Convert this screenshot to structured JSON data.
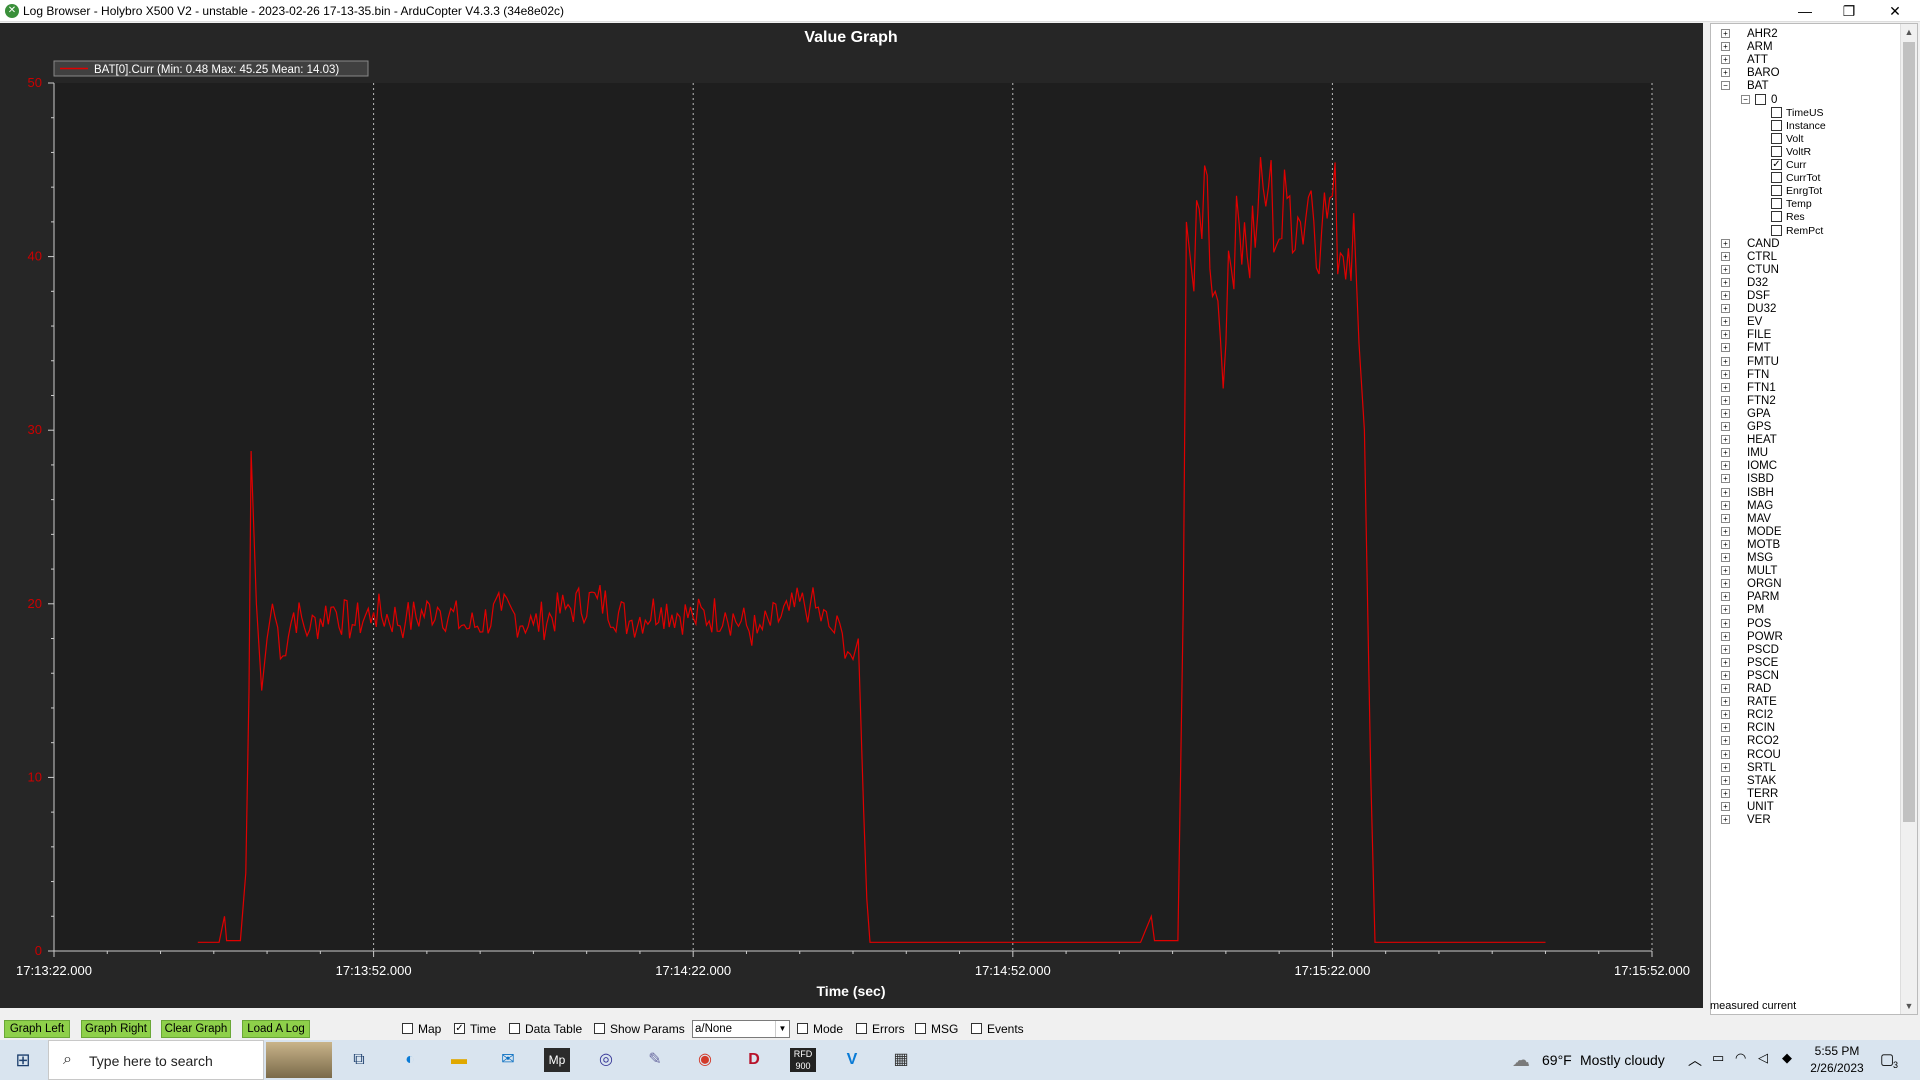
{
  "window": {
    "title": "Log Browser - Holybro X500 V2 - unstable - 2023-02-26 17-13-35.bin - ArduCopter V4.3.3 (34e8e02c)",
    "minimize": "—",
    "maximize": "❐",
    "close": "✕"
  },
  "graph": {
    "title": "Value Graph",
    "legend": "BAT[0].Curr  (Min: 0.48 Max: 45.25 Mean: 14.03)",
    "xlabel": "Time (sec)",
    "colors": {
      "line": "#e00000",
      "plot_bg": "#1e1e1e",
      "axis_labels": "#cc0000"
    }
  },
  "chart_data": {
    "type": "line",
    "title": "Value Graph",
    "xlabel": "Time (sec)",
    "ylabel": "",
    "x_ticks": [
      "17:13:22.000",
      "17:13:52.000",
      "17:14:22.000",
      "17:14:52.000",
      "17:15:22.000",
      "17:15:52.000"
    ],
    "y_ticks": [
      0,
      10,
      20,
      30,
      40,
      50
    ],
    "xlim": [
      "17:13:22",
      "17:15:52"
    ],
    "ylim": [
      0,
      50
    ],
    "grid": "vertical dotted",
    "legend_position": "top-left",
    "series": [
      {
        "name": "BAT[0].Curr  (Min: 0.48 Max: 45.25 Mean: 14.03)",
        "color": "#e00000",
        "points": [
          [
            "17:13:35.5",
            0.5
          ],
          [
            "17:13:37.5",
            0.5
          ],
          [
            "17:13:38.0",
            2.0
          ],
          [
            "17:13:38.2",
            0.6
          ],
          [
            "17:13:39.5",
            0.6
          ],
          [
            "17:13:40.0",
            4.5
          ],
          [
            "17:13:40.3",
            15.0
          ],
          [
            "17:13:40.5",
            28.8
          ],
          [
            "17:13:41.0",
            20.0
          ],
          [
            "17:13:41.5",
            15.0
          ],
          [
            "17:13:42.0",
            18.0
          ],
          [
            "17:13:42.5",
            20.0
          ],
          [
            "17:13:43.5",
            17.0
          ],
          [
            "17:13:44.5",
            19.5
          ],
          [
            "17:13:46",
            18.5
          ],
          [
            "17:13:48",
            19.8
          ],
          [
            "17:13:50",
            18.8
          ],
          [
            "17:13:52",
            19.5
          ],
          [
            "17:13:55",
            19.0
          ],
          [
            "17:13:58",
            19.8
          ],
          [
            "17:14:01",
            18.6
          ],
          [
            "17:14:04",
            19.6
          ],
          [
            "17:14:07",
            18.8
          ],
          [
            "17:14:10",
            19.7
          ],
          [
            "17:14:13",
            20.3
          ],
          [
            "17:14:16",
            19.0
          ],
          [
            "17:14:19",
            19.8
          ],
          [
            "17:14:22",
            19.2
          ],
          [
            "17:14:25",
            19.5
          ],
          [
            "17:14:28",
            18.3
          ],
          [
            "17:14:31",
            19.6
          ],
          [
            "17:14:33",
            20.0
          ],
          [
            "17:14:35",
            18.5
          ],
          [
            "17:14:36",
            18.3
          ],
          [
            "17:14:37",
            16.8
          ],
          [
            "17:14:37.5",
            18.0
          ],
          [
            "17:14:38.0",
            8.0
          ],
          [
            "17:14:38.3",
            3.0
          ],
          [
            "17:14:38.6",
            0.5
          ],
          [
            "17:14:45",
            0.5
          ],
          [
            "17:14:55",
            0.5
          ],
          [
            "17:15:04",
            0.5
          ],
          [
            "17:15:05",
            2.0
          ],
          [
            "17:15:05.3",
            0.6
          ],
          [
            "17:15:07.5",
            0.6
          ],
          [
            "17:15:08.0",
            20.0
          ],
          [
            "17:15:08.3",
            42.0
          ],
          [
            "17:15:09",
            38.0
          ],
          [
            "17:15:10",
            45.25
          ],
          [
            "17:15:11",
            38.0
          ],
          [
            "17:15:12",
            35.0
          ],
          [
            "17:15:13",
            43.5
          ],
          [
            "17:15:14",
            40.0
          ],
          [
            "17:15:15",
            42.5
          ],
          [
            "17:15:16",
            44.0
          ],
          [
            "17:15:17",
            41.0
          ],
          [
            "17:15:18",
            43.5
          ],
          [
            "17:15:19",
            42.0
          ],
          [
            "17:15:20",
            43.8
          ],
          [
            "17:15:21",
            41.5
          ],
          [
            "17:15:22",
            43.5
          ],
          [
            "17:15:23",
            40.0
          ],
          [
            "17:15:24",
            42.5
          ],
          [
            "17:15:24.5",
            35.0
          ],
          [
            "17:15:25",
            30.0
          ],
          [
            "17:15:25.6",
            10.0
          ],
          [
            "17:15:26.0",
            0.5
          ],
          [
            "17:15:35",
            0.5
          ],
          [
            "17:15:42",
            0.5
          ]
        ]
      }
    ]
  },
  "tree": {
    "groups_before": [
      "AHR2",
      "ARM",
      "ATT",
      "BARO"
    ],
    "expanded_group": "BAT",
    "instance": "0",
    "fields": [
      {
        "label": "TimeUS",
        "checked": false
      },
      {
        "label": "Instance",
        "checked": false
      },
      {
        "label": "Volt",
        "checked": false
      },
      {
        "label": "VoltR",
        "checked": false
      },
      {
        "label": "Curr",
        "checked": true
      },
      {
        "label": "CurrTot",
        "checked": false
      },
      {
        "label": "EnrgTot",
        "checked": false
      },
      {
        "label": "Temp",
        "checked": false
      },
      {
        "label": "Res",
        "checked": false
      },
      {
        "label": "RemPct",
        "checked": false
      }
    ],
    "groups_after": [
      "CAND",
      "CTRL",
      "CTUN",
      "D32",
      "DSF",
      "DU32",
      "EV",
      "FILE",
      "FMT",
      "FMTU",
      "FTN",
      "FTN1",
      "FTN2",
      "GPA",
      "GPS",
      "HEAT",
      "IMU",
      "IOMC",
      "ISBD",
      "ISBH",
      "MAG",
      "MAV",
      "MODE",
      "MOTB",
      "MSG",
      "MULT",
      "ORGN",
      "PARM",
      "PM",
      "POS",
      "POWR",
      "PSCD",
      "PSCE",
      "PSCN",
      "RAD",
      "RATE",
      "RCI2",
      "RCIN",
      "RCO2",
      "RCOU",
      "SRTL",
      "STAK",
      "TERR",
      "UNIT",
      "VER"
    ],
    "status": "measured current"
  },
  "toolbar": {
    "buttons": [
      "Graph Left",
      "Graph Right",
      "Clear Graph",
      "Load A Log"
    ],
    "options": [
      {
        "label": "Map",
        "checked": false
      },
      {
        "label": "Time",
        "checked": true
      },
      {
        "label": "Data Table",
        "checked": false
      },
      {
        "label": "Show Params",
        "checked": false
      }
    ],
    "combo_value": "a/None",
    "options2": [
      {
        "label": "Mode",
        "checked": false
      },
      {
        "label": "Errors",
        "checked": false
      },
      {
        "label": "MSG",
        "checked": false
      },
      {
        "label": "Events",
        "checked": false
      }
    ]
  },
  "taskbar": {
    "search_placeholder": "Type here to search",
    "weather_temp": "69°F",
    "weather_desc": "Mostly cloudy",
    "time": "5:55 PM",
    "date": "2/26/2023",
    "notifications": "3",
    "apps": [
      "windows-start-icon",
      "task-view-icon",
      "edge-icon",
      "file-explorer-icon",
      "mail-icon",
      "mission-planner-icon",
      "quicktime-icon",
      "feather-icon",
      "chrome-icon",
      "d-app-icon",
      "rfd900-icon",
      "vscode-icon",
      "calculator-icon"
    ]
  }
}
